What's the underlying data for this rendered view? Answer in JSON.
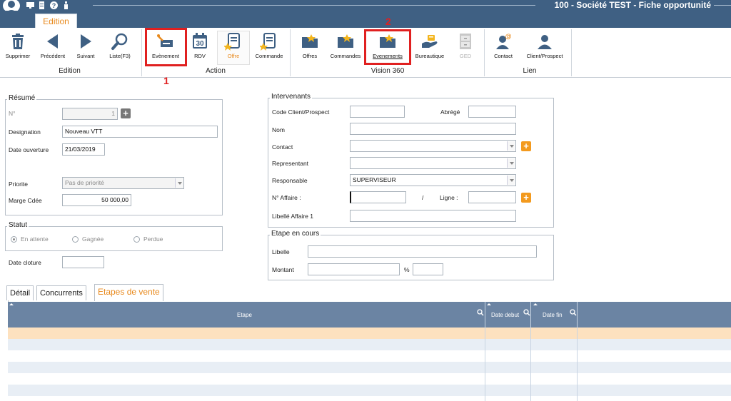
{
  "window": {
    "title": "100 - Société TEST - Fiche opportunité"
  },
  "ribbon": {
    "tab_label": "Edition",
    "groups": {
      "edition": "Edition",
      "action": "Action",
      "vision": "Vision 360",
      "lien": "Lien"
    },
    "buttons": {
      "supprimer": "Supprimer",
      "precedent": "Précédent",
      "suivant": "Suivant",
      "liste": "Liste(F3)",
      "evenement": "Evènement",
      "rdv": "RDV",
      "offre": "Offre",
      "commande": "Commande",
      "offres": "Offres",
      "commandes": "Commandes",
      "evenements": "Evenements",
      "bureautique": "Bureautique",
      "ged": "GED",
      "contact": "Contact",
      "client_prospect": "Client/Prospect"
    },
    "rdv_day": "30",
    "annotations": {
      "n1": "1",
      "n2": "2"
    },
    "accent": "#e02020"
  },
  "resume": {
    "legend": "Résumé",
    "no_label": "N°",
    "no_value": "1",
    "designation_label": "Designation",
    "designation_value": "Nouveau VTT",
    "date_ouverture_label": "Date ouverture",
    "date_ouverture_value": "21/03/2019",
    "priorite_label": "Priorite",
    "priorite_value": "Pas de priorité",
    "marge_label": "Marge Cdée",
    "marge_value": "50 000,00"
  },
  "statut": {
    "legend": "Statut",
    "options": [
      "En attente",
      "Gagnée",
      "Perdue"
    ],
    "date_cloture_label": "Date cloture",
    "date_cloture_value": ""
  },
  "intervenants": {
    "legend": "Intervenants",
    "code_client_label": "Code Client/Prospect",
    "code_client_value": "",
    "abrege_label": "Abrégé",
    "abrege_value": "",
    "nom_label": "Nom",
    "nom_value": "",
    "contact_label": "Contact",
    "contact_value": "",
    "representant_label": "Representant",
    "representant_value": "",
    "responsable_label": "Responsable",
    "responsable_value": "SUPERVISEUR",
    "affaire_label": "N° Affaire :",
    "affaire_value": "",
    "slash": "/",
    "ligne_label": "Ligne :",
    "ligne_value": "",
    "libelle_affaire_label": "Libellé Affaire 1",
    "libelle_affaire_value": ""
  },
  "etape": {
    "legend": "Etape en cours",
    "libelle_label": "Libelle",
    "libelle_value": "",
    "montant_label": "Montant",
    "montant_value": "",
    "percent": "%",
    "percent_value": ""
  },
  "tabs": {
    "detail": "Détail",
    "concurrents": "Concurrents",
    "etapes": "Etapes de vente"
  },
  "grid": {
    "col_etape": "Etape",
    "col_date_debut": "Date debut",
    "col_date_fin": "Date fin",
    "header_color": "#6b84a3",
    "selected_row_color": "#fde1bf"
  }
}
